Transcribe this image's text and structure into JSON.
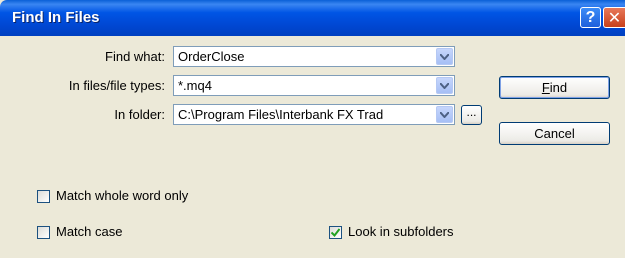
{
  "window": {
    "title": "Find In Files",
    "help_glyph": "?",
    "close_glyph": "✕"
  },
  "form": {
    "find_what": {
      "label": "Find what:",
      "value": "OrderClose"
    },
    "file_types": {
      "label": "In files/file types:",
      "value": "*.mq4"
    },
    "in_folder": {
      "label": "In folder:",
      "value": "C:\\Program Files\\Interbank FX Trad"
    },
    "browse_label": "..."
  },
  "buttons": {
    "find_first": "F",
    "find_rest": "ind",
    "cancel": "Cancel"
  },
  "options": {
    "match_whole_word": {
      "label": "Match whole word only",
      "checked": false
    },
    "match_case": {
      "label": "Match case",
      "checked": false
    },
    "look_in_subfolders": {
      "label": "Look in subfolders",
      "checked": true
    }
  }
}
